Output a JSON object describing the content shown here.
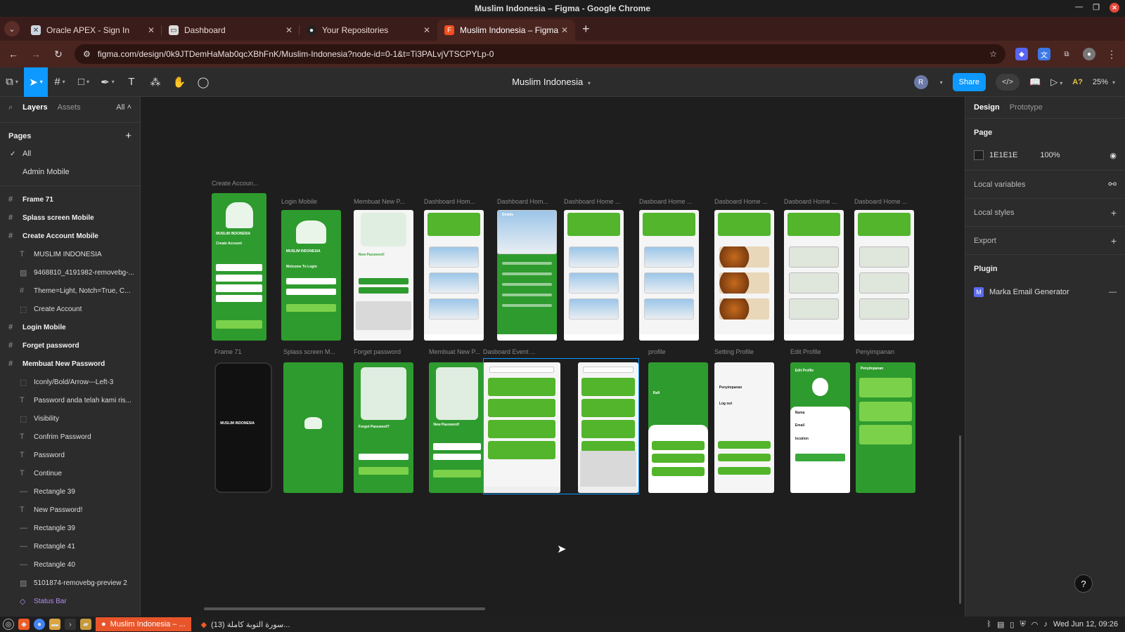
{
  "window": {
    "title": "Muslim Indonesia – Figma - Google Chrome"
  },
  "tabs": [
    {
      "label": "Oracle APEX - Sign In",
      "icon": "apex-icon",
      "active": false
    },
    {
      "label": "Dashboard",
      "icon": "page-icon",
      "active": false
    },
    {
      "label": "Your Repositories",
      "icon": "github-icon",
      "active": false
    },
    {
      "label": "Muslim Indonesia – Figma",
      "icon": "figma-icon",
      "active": true
    }
  ],
  "omnibox": {
    "url": "figma.com/design/0k9JTDemHaMab0qcXBhFnK/Muslim-Indonesia?node-id=0-1&t=Ti3PALvjVTSCPYLp-0"
  },
  "figma": {
    "file_title": "Muslim Indonesia",
    "avatar": "R",
    "share": "Share",
    "zoom": "25%",
    "ai_label": "A?"
  },
  "left_panel": {
    "tab_layers": "Layers",
    "tab_assets": "Assets",
    "filter": "All",
    "pages_heading": "Pages",
    "pages": [
      "All",
      "Admin Mobile"
    ],
    "layers": [
      {
        "label": "Frame 71",
        "kind": "frame",
        "level": 0
      },
      {
        "label": "Splass screen Mobile",
        "kind": "frame",
        "level": 0
      },
      {
        "label": "Create Account Mobile",
        "kind": "frame",
        "level": 0
      },
      {
        "label": "MUSLIM INDONESIA",
        "kind": "text",
        "level": 1
      },
      {
        "label": "9468810_4191982-removebg-...",
        "kind": "image",
        "level": 1
      },
      {
        "label": "Theme=Light, Notch=True, C...",
        "kind": "frame",
        "level": 1
      },
      {
        "label": "Create Account",
        "kind": "group",
        "level": 1
      },
      {
        "label": "Login Mobile",
        "kind": "frame",
        "level": 0
      },
      {
        "label": "Forget password",
        "kind": "frame",
        "level": 0
      },
      {
        "label": "Membuat New Password",
        "kind": "frame",
        "level": 0
      },
      {
        "label": "Iconly/Bold/Arrow---Left-3",
        "kind": "group",
        "level": 1
      },
      {
        "label": "Password anda telah kami ris...",
        "kind": "text",
        "level": 1
      },
      {
        "label": "Visibility",
        "kind": "group",
        "level": 1
      },
      {
        "label": "Confrim Password",
        "kind": "text",
        "level": 1
      },
      {
        "label": "Password",
        "kind": "text",
        "level": 1
      },
      {
        "label": "Continue",
        "kind": "text",
        "level": 1
      },
      {
        "label": "Rectangle 39",
        "kind": "rect",
        "level": 1
      },
      {
        "label": "New Password!",
        "kind": "text",
        "level": 1
      },
      {
        "label": "Rectangle 39",
        "kind": "rect",
        "level": 1
      },
      {
        "label": "Rectangle 41",
        "kind": "rect",
        "level": 1
      },
      {
        "label": "Rectangle 40",
        "kind": "rect",
        "level": 1
      },
      {
        "label": "5101874-removebg-preview 2",
        "kind": "image",
        "level": 1
      },
      {
        "label": "Status Bar",
        "kind": "component",
        "level": 1
      }
    ]
  },
  "canvas": {
    "row1": [
      {
        "label": "Create Accoun...",
        "style": "green"
      },
      {
        "label": "Login Mobile",
        "style": "green"
      },
      {
        "label": "Membuat New P...",
        "style": "white"
      },
      {
        "label": "Dashboard Hom...",
        "style": "white"
      },
      {
        "label": "Dashboard Hom...",
        "style": "green"
      },
      {
        "label": "Dashboard Home ...",
        "style": "white"
      },
      {
        "label": "Dasboard Home ...",
        "style": "white"
      },
      {
        "label": "Dasboard Home ...",
        "style": "white"
      },
      {
        "label": "Dasboard Home ...",
        "style": "white"
      },
      {
        "label": "Dasboard Home ...",
        "style": "white"
      }
    ],
    "row2": [
      {
        "label": "Frame 71",
        "style": "dark"
      },
      {
        "label": "Splass screen M...",
        "style": "green"
      },
      {
        "label": "Forget password",
        "style": "green"
      },
      {
        "label": "Membuat New P...",
        "style": "green"
      },
      {
        "label": "Dasboard Event ...",
        "style": "white"
      },
      {
        "label": "",
        "style": "white"
      },
      {
        "label": "profile",
        "style": "white"
      },
      {
        "label": "Setting Profile",
        "style": "white"
      },
      {
        "label": "Edit Profile",
        "style": "green"
      },
      {
        "label": "Penyimpanan",
        "style": "green"
      }
    ],
    "frame_texts": {
      "muslim_indonesia": "MUSLIM INDONESIA",
      "create_account": "Create Account",
      "welcome": "Welcome To Login",
      "new_password": "New Password!",
      "forgot_password": "Forgot Password?",
      "details": "Details",
      "rafi": "Rafi",
      "penyimpanan": "Penyimpanan",
      "log_out": "Log out",
      "edit_profile": "Edit Profile",
      "nama": "Nama",
      "email": "Email",
      "location": "location"
    }
  },
  "right_panel": {
    "tab_design": "Design",
    "tab_prototype": "Prototype",
    "page_heading": "Page",
    "page_color": "1E1E1E",
    "page_opacity": "100%",
    "local_variables": "Local variables",
    "local_styles": "Local styles",
    "export": "Export",
    "plugin_heading": "Plugin",
    "plugin_name": "Marka Email Generator"
  },
  "taskbar": {
    "tasks": [
      {
        "label": "Muslim Indonesia – ...",
        "active": true
      },
      {
        "label": "سورة التوبة كاملة (13)...",
        "active": false
      }
    ],
    "clock": "Wed Jun 12, 09:26"
  }
}
